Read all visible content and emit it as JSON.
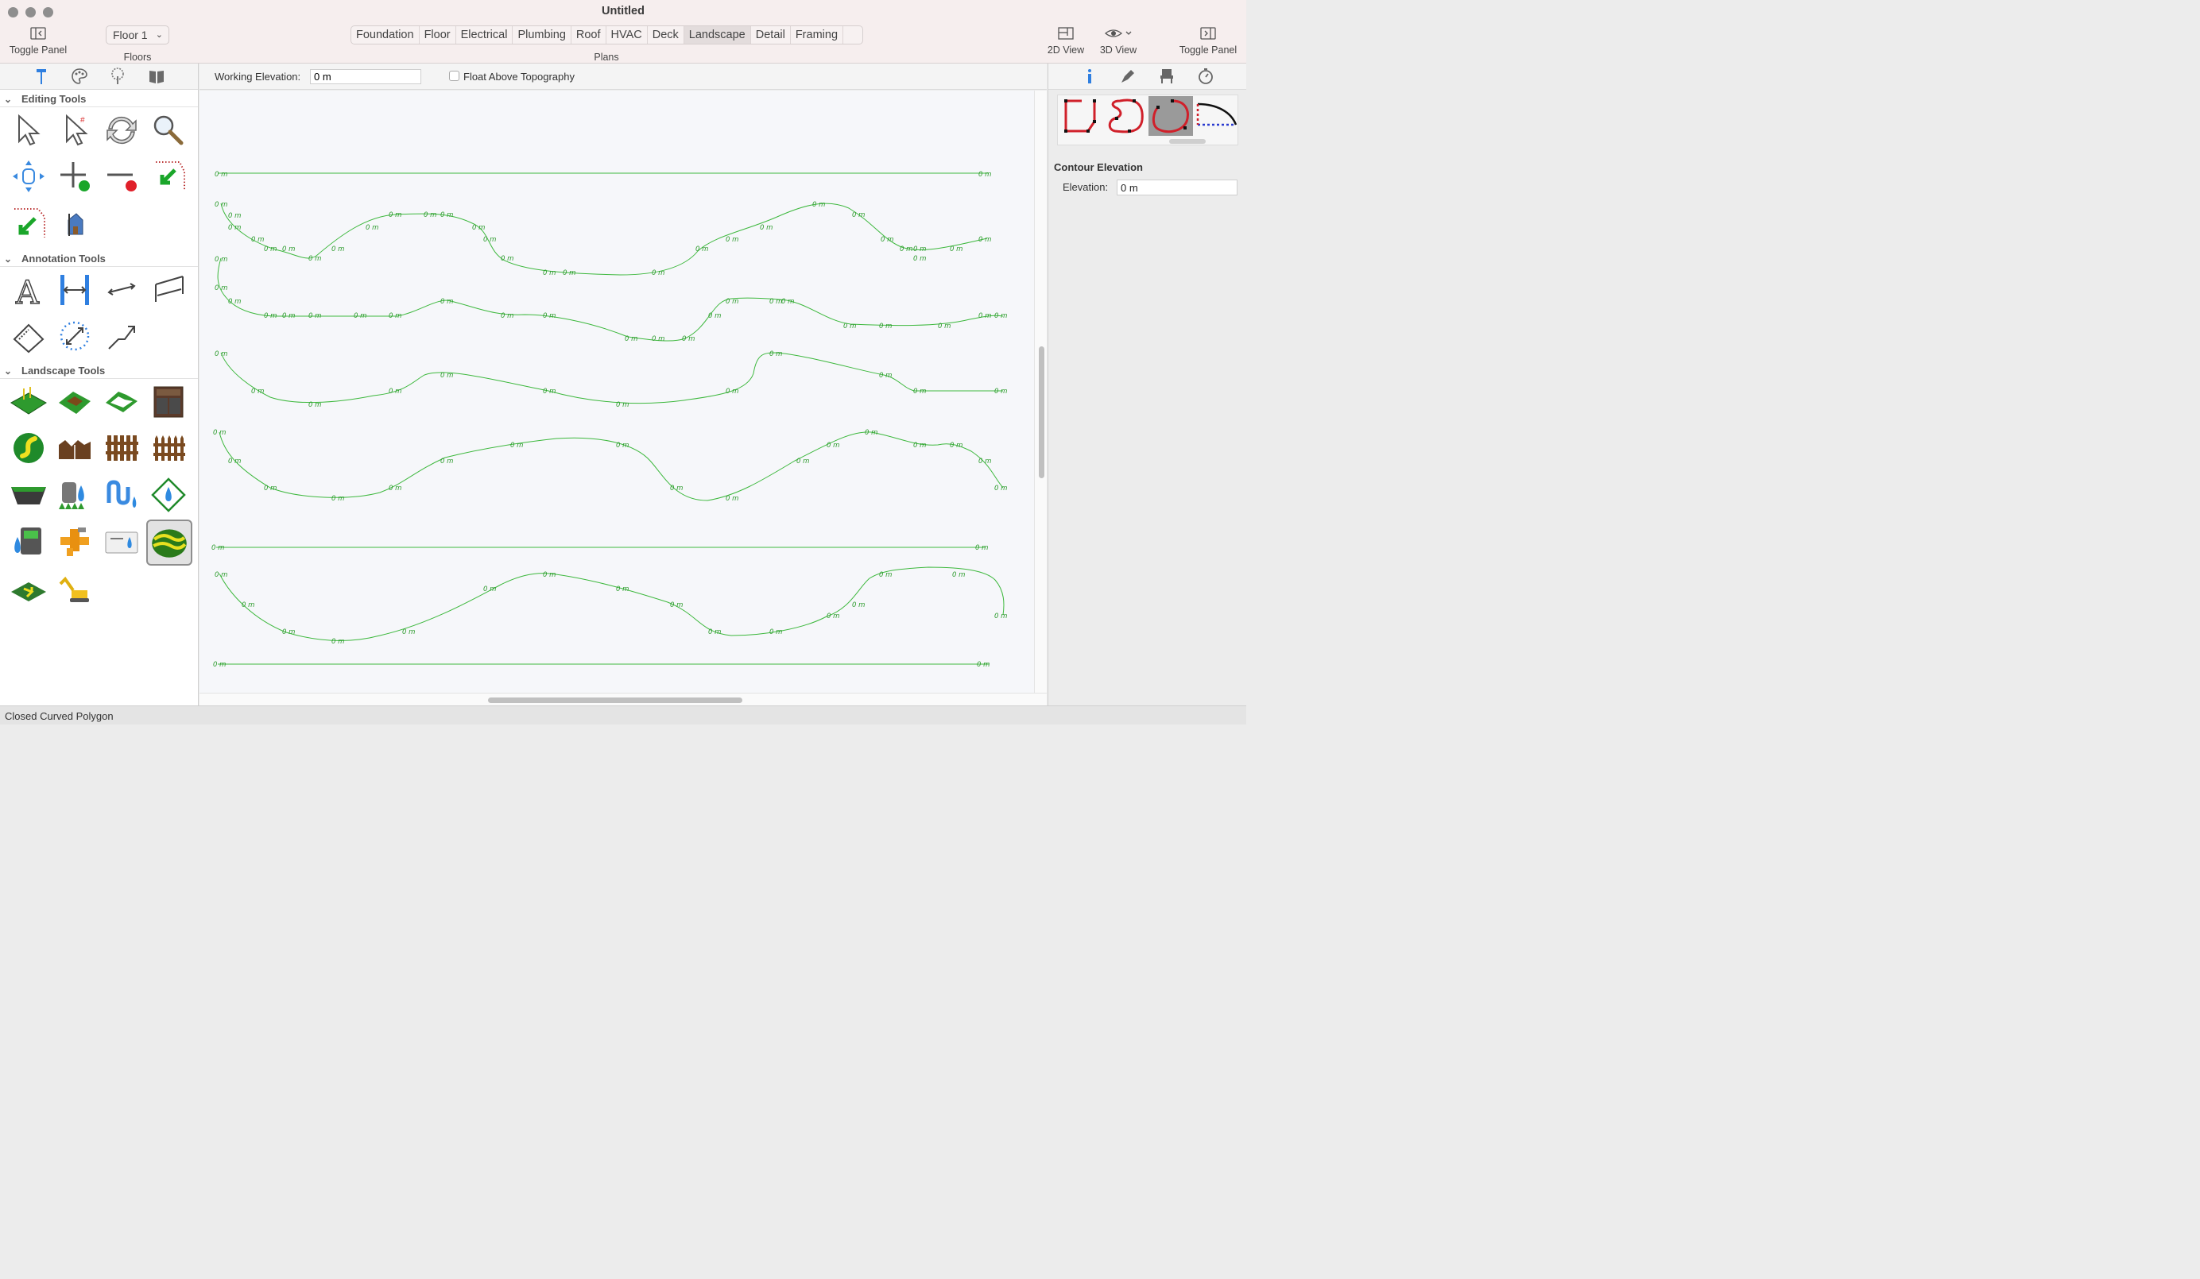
{
  "window": {
    "title": "Untitled"
  },
  "toolbar": {
    "toggle_left_label": "Toggle Panel",
    "floors_label": "Floors",
    "floor_selected": "Floor 1",
    "plans_label": "Plans",
    "plans_tabs": [
      "Foundation",
      "Floor",
      "Electrical",
      "Plumbing",
      "Roof",
      "HVAC",
      "Deck",
      "Landscape",
      "Detail",
      "Framing"
    ],
    "plans_active": "Landscape",
    "view2d_label": "2D View",
    "view3d_label": "3D View",
    "toggle_right_label": "Toggle Panel"
  },
  "left_panel": {
    "tabs": [
      "hammer-icon",
      "palette-icon",
      "tree-icon",
      "book-icon"
    ],
    "sections": {
      "editing": "Editing Tools",
      "annotation": "Annotation Tools",
      "landscape": "Landscape Tools"
    },
    "selected_tool": "contour-tool"
  },
  "elevation_bar": {
    "working_elevation_label": "Working Elevation:",
    "working_elevation_value": "0 m",
    "float_label": "Float Above Topography",
    "float_checked": false
  },
  "canvas": {
    "contour_label": "0 m",
    "line_color": "#3db83d"
  },
  "right_panel": {
    "tabs": [
      "info-icon",
      "pen-icon",
      "chair-icon",
      "timer-icon"
    ],
    "shapes": [
      "open-polygon-shape",
      "closed-curved-polygon-shape",
      "selected-curve-shape",
      "arc-shape"
    ],
    "contour_title": "Contour Elevation",
    "elevation_label": "Elevation:",
    "elevation_value": "0 m"
  },
  "status": {
    "text": "Closed Curved Polygon"
  }
}
